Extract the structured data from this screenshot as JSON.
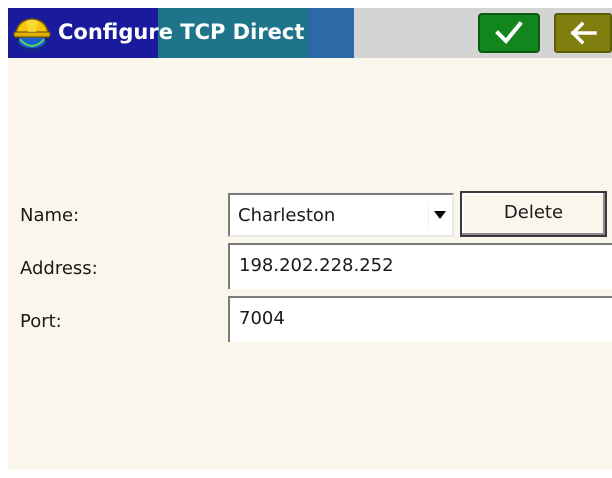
{
  "window": {
    "title": "Configure TCP Direct",
    "logo_icon": "hardhat-globe-icon",
    "ok_icon": "checkmark-icon",
    "back_icon": "back-arrow-icon",
    "colors": {
      "title_left": "#1a1a9c",
      "title_mid": "#1e7488",
      "title_right": "#d4d4d4",
      "ok_button": "#12861c",
      "back_button": "#817e10",
      "background": "#faf6ec"
    }
  },
  "form": {
    "name": {
      "label": "Name:",
      "selected": "Charleston",
      "dropdown_icon": "dropdown-arrow-icon",
      "delete_label": "Delete"
    },
    "address": {
      "label": "Address:",
      "value": "198.202.228.252"
    },
    "port": {
      "label": "Port:",
      "value": "7004"
    }
  }
}
